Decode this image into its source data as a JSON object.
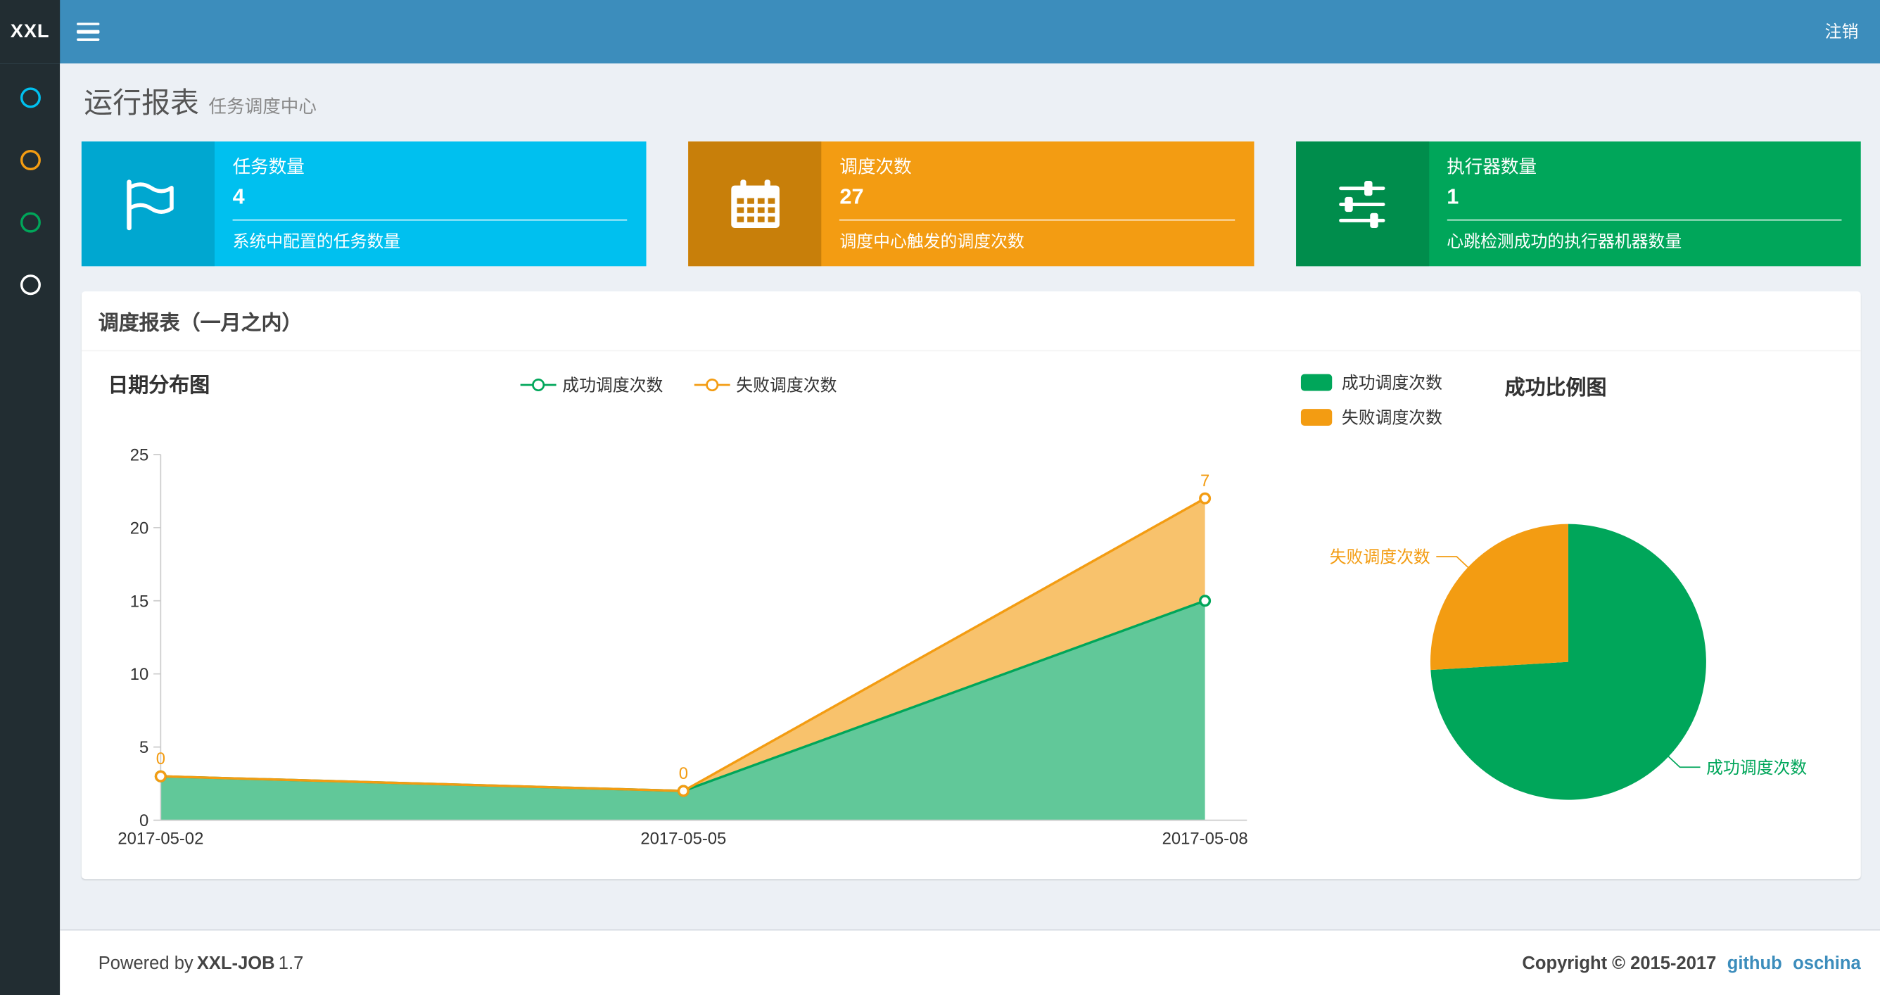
{
  "navbar": {
    "logo_mini": "XXL",
    "logout_label": "注销"
  },
  "sidebar": {
    "items": [
      {
        "name": "sidebar-item-1",
        "color": "#00c0ef"
      },
      {
        "name": "sidebar-item-2",
        "color": "#f39c12"
      },
      {
        "name": "sidebar-item-3",
        "color": "#00a65a"
      },
      {
        "name": "sidebar-item-4",
        "color": "#ffffff"
      }
    ]
  },
  "header": {
    "title": "运行报表",
    "subtitle": "任务调度中心"
  },
  "info_boxes": [
    {
      "title": "任务数量",
      "value": "4",
      "desc": "系统中配置的任务数量",
      "color": "#00c0ef",
      "icon": "flag-icon"
    },
    {
      "title": "调度次数",
      "value": "27",
      "desc": "调度中心触发的调度次数",
      "color": "#f39c12",
      "icon": "calendar-icon"
    },
    {
      "title": "执行器数量",
      "value": "1",
      "desc": "心跳检测成功的执行器机器数量",
      "color": "#00a65a",
      "icon": "sliders-icon"
    }
  ],
  "panel": {
    "title": "调度报表（一月之内）"
  },
  "chart_data": [
    {
      "type": "area",
      "title": "日期分布图",
      "stacked": true,
      "x": [
        "2017-05-02",
        "2017-05-05",
        "2017-05-08"
      ],
      "series": [
        {
          "name": "成功调度次数",
          "values": [
            3,
            2,
            15
          ],
          "color": "#00a65a"
        },
        {
          "name": "失败调度次数",
          "values": [
            0,
            0,
            7
          ],
          "color": "#f39c12"
        }
      ],
      "point_labels": [
        "0",
        "0",
        "7"
      ],
      "ylim": [
        0,
        25
      ],
      "yticks": [
        0,
        5,
        10,
        15,
        20,
        25
      ],
      "grid": false,
      "legend_position": "top-center"
    },
    {
      "type": "pie",
      "title": "成功比例图",
      "slices": [
        {
          "name": "成功调度次数",
          "value": 20,
          "color": "#00a65a"
        },
        {
          "name": "失败调度次数",
          "value": 7,
          "color": "#f39c12"
        }
      ],
      "legend_position": "top-left"
    }
  ],
  "footer": {
    "powered_by": "Powered by",
    "app_name": "XXL-JOB",
    "version": "1.7",
    "copyright": "Copyright © 2015-2017",
    "links": [
      {
        "label": "github"
      },
      {
        "label": "oschina"
      }
    ]
  },
  "colors": {
    "navbar": "#3c8dbc",
    "sidebar": "#222d32",
    "content_bg": "#ecf0f5",
    "success": "#00a65a",
    "fail": "#f39c12",
    "aqua": "#00c0ef",
    "link": "#3c8dbc"
  }
}
